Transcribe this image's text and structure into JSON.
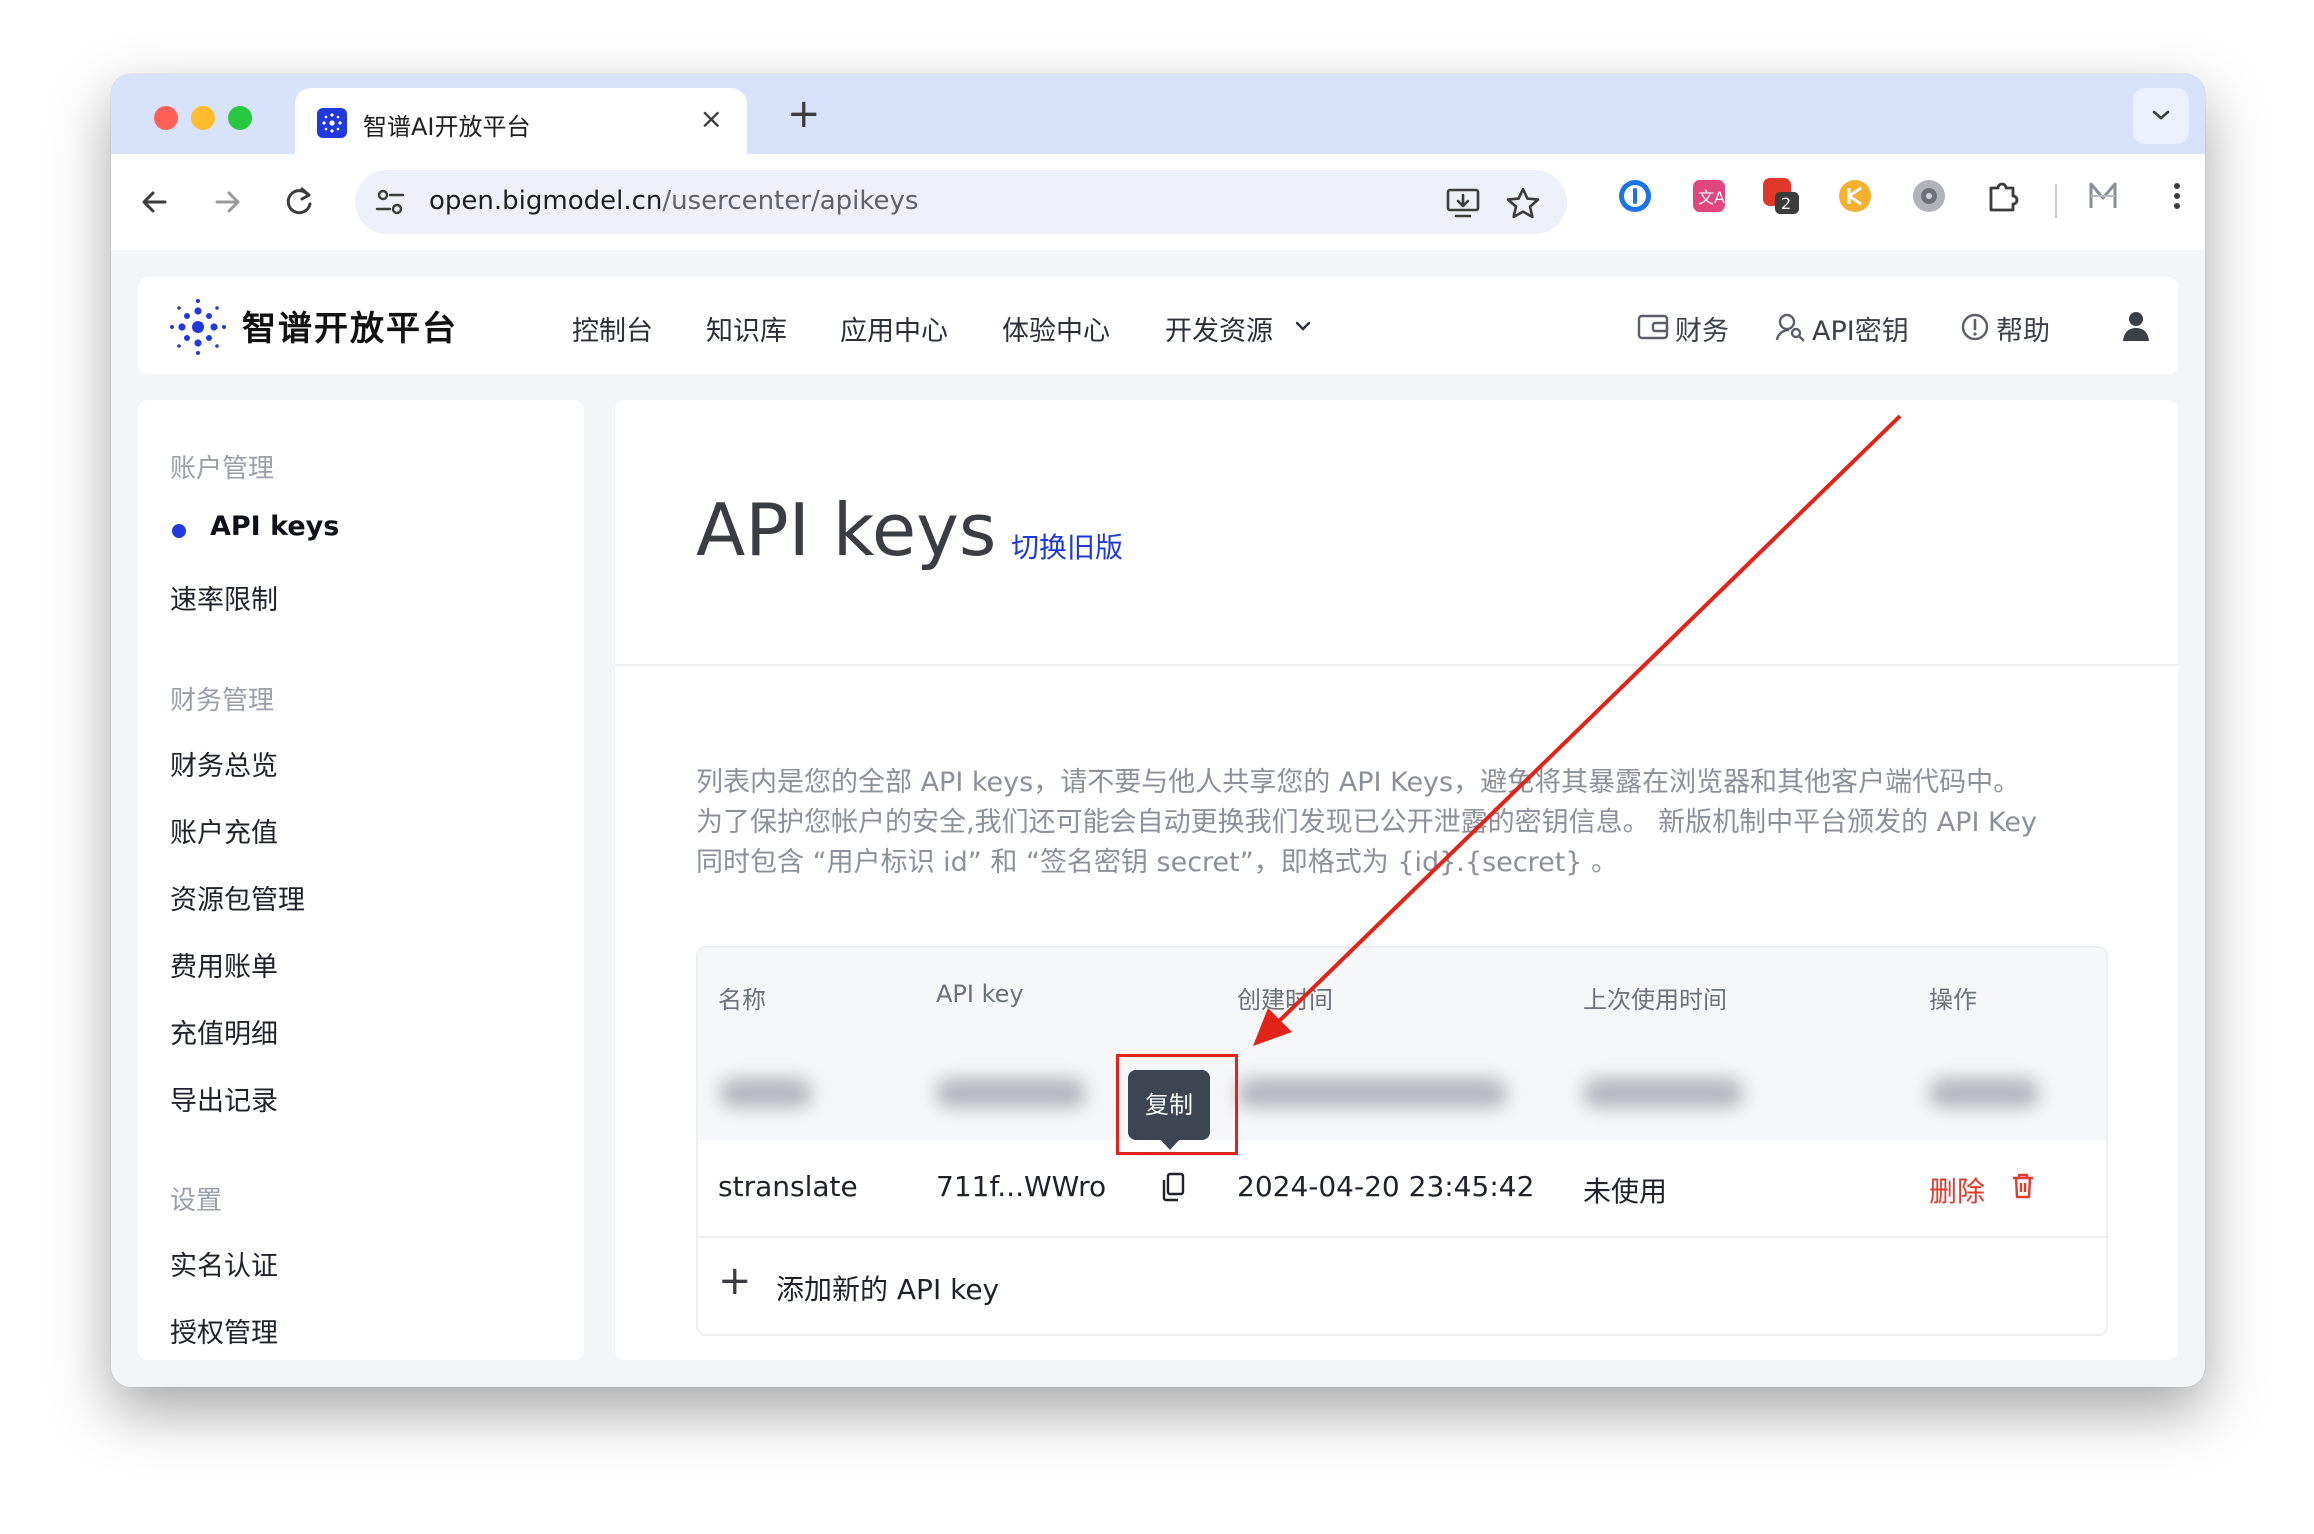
{
  "browser": {
    "tab_title": "智谱AI开放平台",
    "tab_close": "×",
    "new_tab": "+",
    "url_host": "open.bigmodel.cn",
    "url_path": "/usercenter/apikeys",
    "extension_badge": "2"
  },
  "site": {
    "brand": "智谱开放平台",
    "nav": [
      "控制台",
      "知识库",
      "应用中心",
      "体验中心",
      "开发资源"
    ],
    "nav_right": {
      "finance": "财务",
      "api_keys": "API密钥",
      "help": "帮助"
    }
  },
  "sidebar": {
    "groups": [
      {
        "title": "账户管理",
        "items": [
          "API keys",
          "速率限制"
        ]
      },
      {
        "title": "财务管理",
        "items": [
          "财务总览",
          "账户充值",
          "资源包管理",
          "费用账单",
          "充值明细",
          "导出记录"
        ]
      },
      {
        "title": "设置",
        "items": [
          "实名认证",
          "授权管理"
        ]
      }
    ],
    "active": "API keys"
  },
  "main": {
    "title": "API keys",
    "switch_link": "切换旧版",
    "description": [
      "列表内是您的全部 API keys，请不要与他人共享您的 API Keys，避免将其暴露在浏览器和其他客户端代码中。",
      "为了保护您帐户的安全,我们还可能会自动更换我们发现已公开泄露的密钥信息。 新版机制中平台颁发的 API Key",
      "同时包含 “用户标识 id” 和 “签名密钥 secret”，即格式为 {id}.{secret} 。"
    ],
    "table": {
      "headers": [
        "名称",
        "API key",
        "创建时间",
        "上次使用时间",
        "操作"
      ],
      "rows": [
        {
          "name": "stranslate",
          "key": "711f...WWro",
          "created": "2024-04-20 23:45:42",
          "last_used": "未使用",
          "action": "删除"
        }
      ],
      "add_label": "添加新的 API key"
    },
    "tooltip": "复制"
  },
  "colors": {
    "brand": "#1f39dd",
    "danger": "#e23b2e",
    "annotation": "#e2231a"
  }
}
